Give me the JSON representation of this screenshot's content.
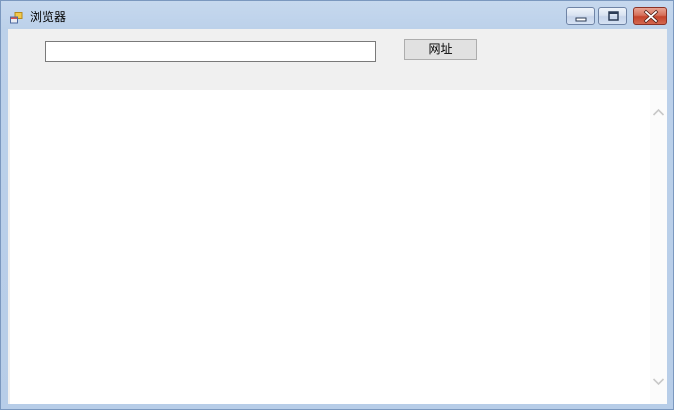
{
  "window": {
    "title": "浏览器"
  },
  "toolbar": {
    "url_input_value": "",
    "url_input_placeholder": "",
    "go_button_label": "网址"
  },
  "icons": {
    "app": "app-window-icon",
    "minimize": "minimize-icon",
    "maximize": "maximize-icon",
    "close": "close-icon",
    "scroll_up": "chevron-up-icon",
    "scroll_down": "chevron-down-icon"
  },
  "colors": {
    "titlebar": "#bcd1ea",
    "client_background": "#f0f0f0",
    "browser_background": "#ffffff",
    "close_button": "#c4432b"
  }
}
